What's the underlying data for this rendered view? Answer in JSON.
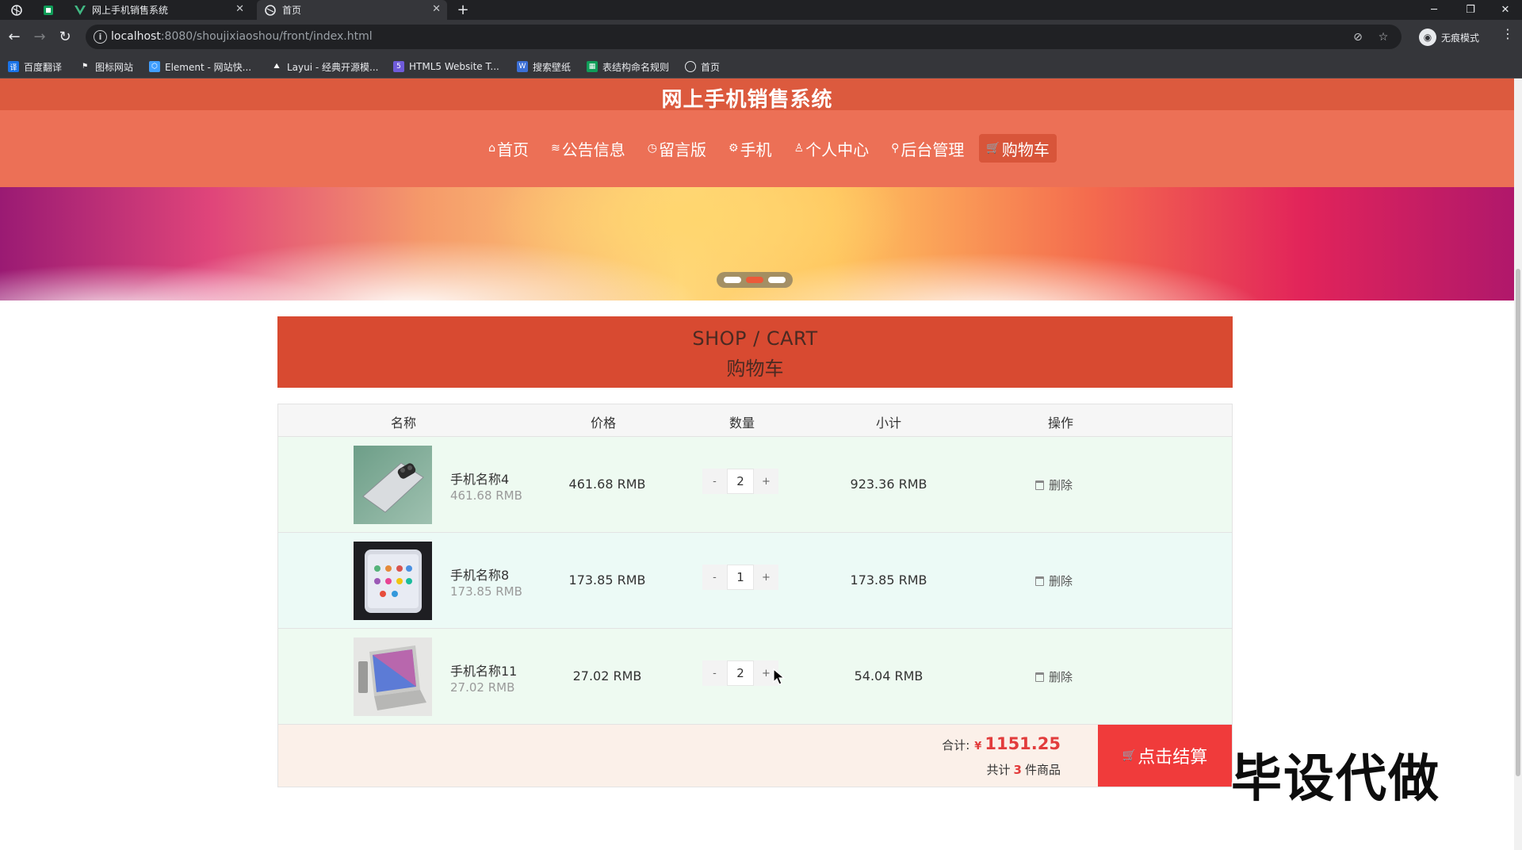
{
  "browser": {
    "tabs": [
      {
        "title": "网上手机销售系统",
        "icon": "vue-icon"
      },
      {
        "title": "首页",
        "icon": "globe-icon"
      }
    ],
    "url_host": "localhost",
    "url_path": ":8080/shoujixiaoshou/front/index.html",
    "profile_label": "无痕模式",
    "bookmarks": [
      {
        "label": "百度翻译",
        "color": "#1a73e8"
      },
      {
        "label": "图标网站",
        "color": "#000000"
      },
      {
        "label": "Element - 网站快...",
        "color": "#409eff"
      },
      {
        "label": "Layui - 经典开源模...",
        "color": "#5fb878"
      },
      {
        "label": "HTML5 Website T...",
        "color": "#6f5bd9"
      },
      {
        "label": "搜索壁纸",
        "color": "#3b6fd6"
      },
      {
        "label": "表结构命名规则",
        "color": "#0f9d58"
      },
      {
        "label": "首页",
        "color": "#9aa0a6"
      }
    ]
  },
  "site": {
    "title": "网上手机销售系统",
    "nav": [
      {
        "label": "首页",
        "icon": "home-icon"
      },
      {
        "label": "公告信息",
        "icon": "list-icon"
      },
      {
        "label": "留言版",
        "icon": "clock-icon"
      },
      {
        "label": "手机",
        "icon": "gear-icon"
      },
      {
        "label": "个人中心",
        "icon": "user-icon"
      },
      {
        "label": "后台管理",
        "icon": "link-icon"
      },
      {
        "label": "购物车",
        "icon": "cart-icon",
        "active": true
      }
    ]
  },
  "cart": {
    "heading_en": "SHOP / CART",
    "heading_zh": "购物车",
    "columns": [
      "名称",
      "价格",
      "数量",
      "小计",
      "操作"
    ],
    "items": [
      {
        "name": "手机名称4",
        "sub_price": "461.68 RMB",
        "price": "461.68 RMB",
        "qty": "2",
        "subtotal": "923.36 RMB",
        "delete": "删除"
      },
      {
        "name": "手机名称8",
        "sub_price": "173.85 RMB",
        "price": "173.85 RMB",
        "qty": "1",
        "subtotal": "173.85 RMB",
        "delete": "删除"
      },
      {
        "name": "手机名称11",
        "sub_price": "27.02 RMB",
        "price": "27.02 RMB",
        "qty": "2",
        "subtotal": "54.04 RMB",
        "delete": "删除"
      }
    ],
    "minus": "-",
    "plus": "+",
    "total_label": "合计:",
    "currency": "¥",
    "total_amount": "1151.25",
    "count_prefix": "共计",
    "count_value": "3",
    "count_suffix": "件商品",
    "checkout_label": "点击结算"
  },
  "watermark": "毕设代做"
}
